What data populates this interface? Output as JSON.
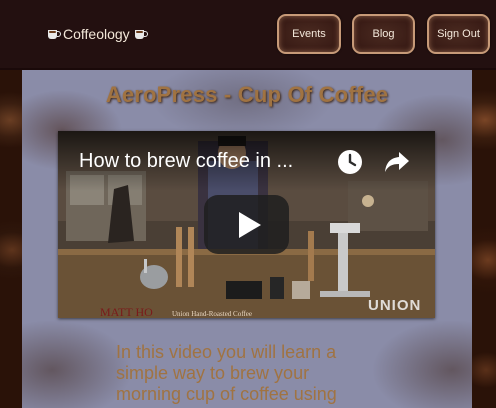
{
  "header": {
    "brand": "Coffeology",
    "brand_icon": "coffee-cup-icon",
    "nav": [
      {
        "label": "Events"
      },
      {
        "label": "Blog"
      },
      {
        "label": "Sign Out"
      }
    ]
  },
  "main": {
    "title": "AeroPress - Cup Of Coffee",
    "video": {
      "title": "How to brew coffee in ...",
      "watermark_name": "MATT HO",
      "watermark_sub": "Union Hand-Roasted Coffee",
      "logo_text": "UNION",
      "icons": [
        "clock-icon",
        "share-icon",
        "play-icon"
      ]
    },
    "description_lines": [
      "In this video you will learn a",
      "simple way to brew your",
      "morning cup of coffee using"
    ]
  },
  "colors": {
    "header_bg": "#231010",
    "panel_bg": "#8a8ca8",
    "title_text": "#a07342",
    "nav_border": "#c79a78"
  }
}
